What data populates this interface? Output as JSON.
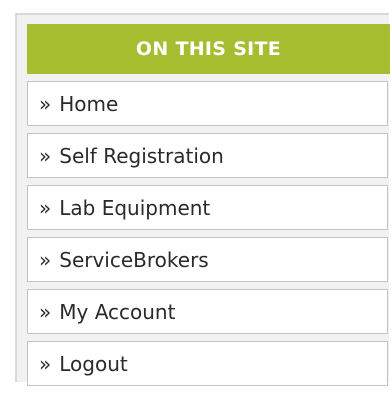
{
  "sidebar": {
    "title": "ON THIS SITE",
    "bullet": "»",
    "items": [
      {
        "label": "Home"
      },
      {
        "label": "Self Registration"
      },
      {
        "label": "Lab Equipment"
      },
      {
        "label": "ServiceBrokers"
      },
      {
        "label": "My Account"
      },
      {
        "label": "Logout"
      }
    ]
  }
}
